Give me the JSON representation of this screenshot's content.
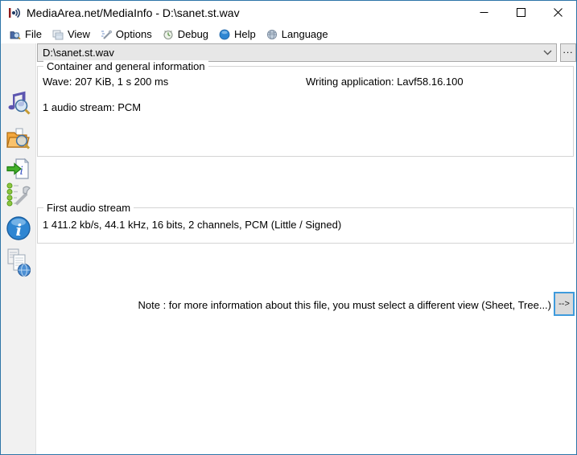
{
  "window": {
    "title": "MediaArea.net/MediaInfo - D:\\sanet.st.wav",
    "controls": [
      {
        "name": "minimize-button",
        "icon": "minimize-icon"
      },
      {
        "name": "maximize-button",
        "icon": "maximize-icon"
      },
      {
        "name": "close-button",
        "icon": "close-icon"
      }
    ]
  },
  "menu": {
    "items": [
      {
        "label": "File",
        "icon": "file-menu-icon"
      },
      {
        "label": "View",
        "icon": "view-menu-icon"
      },
      {
        "label": "Options",
        "icon": "options-menu-icon"
      },
      {
        "label": "Debug",
        "icon": "debug-menu-icon"
      },
      {
        "label": "Help",
        "icon": "help-menu-icon"
      },
      {
        "label": "Language",
        "icon": "language-menu-icon"
      }
    ]
  },
  "toolbar": {
    "items": [
      {
        "icon": "open-file-icon"
      },
      {
        "icon": "open-folder-icon"
      },
      {
        "icon": "export-info-icon"
      },
      {
        "icon": "preferences-icon"
      },
      {
        "icon": "about-icon"
      },
      {
        "icon": "web-documents-icon"
      }
    ]
  },
  "file_selector": {
    "value": "D:\\sanet.st.wav",
    "browse_label": "...",
    "chevron": "chevron-down-icon"
  },
  "general_info": {
    "legend": "Container and general information",
    "format_line": "Wave: 207 KiB, 1 s 200 ms",
    "writing_application_line": "Writing application: Lavf58.16.100",
    "stream_line": "1 audio stream: PCM"
  },
  "audio_stream": {
    "legend": "First audio stream",
    "summary_line": "1 411.2 kb/s, 44.1 kHz, 16 bits, 2 channels, PCM (Little / Signed)"
  },
  "note": {
    "text": "Note : for more information about this file, you must select a different view (Sheet, Tree...)",
    "button_label": "-->"
  },
  "colors": {
    "window_border": "#2e75a8",
    "toolstrip_bg": "#f1f1f1",
    "combo_bg": "#e7e7e7",
    "groupbox_border": "#d4d4d4",
    "focus_border": "#3f9bdc"
  }
}
